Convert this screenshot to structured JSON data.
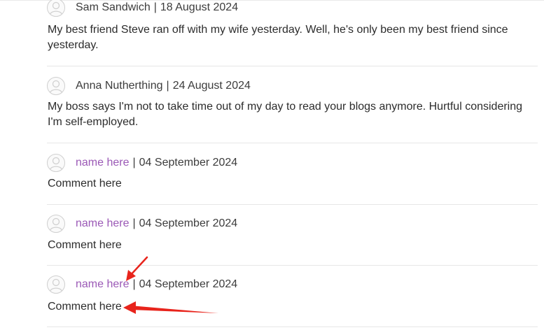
{
  "comments": [
    {
      "author": "Sam Sandwich",
      "separator": "|",
      "date": "18 August 2024",
      "text": "My best friend Steve ran off with my wife yesterday. Well, he's only been my best friend since yesterday."
    },
    {
      "author": "Anna Nutherthing",
      "separator": "|",
      "date": "24 August 2024",
      "text": "My boss says I'm not to take time out of my day to read your blogs anymore. Hurtful considering I'm self-employed."
    },
    {
      "author": "name here",
      "separator": "|",
      "date": "04 September 2024",
      "text": "Comment here"
    },
    {
      "author": "name here",
      "separator": "|",
      "date": "04 September 2024",
      "text": "Comment here"
    },
    {
      "author": "name here",
      "separator": "|",
      "date": "04 September 2024",
      "text": "Comment here"
    }
  ],
  "icons": {
    "avatar": "user-avatar-icon",
    "annotation": "red-arrow-annotation"
  },
  "colors": {
    "author_link": "#9b59b6",
    "text": "#333333",
    "divider": "#e6e6e6",
    "annotation": "#e8241c"
  }
}
